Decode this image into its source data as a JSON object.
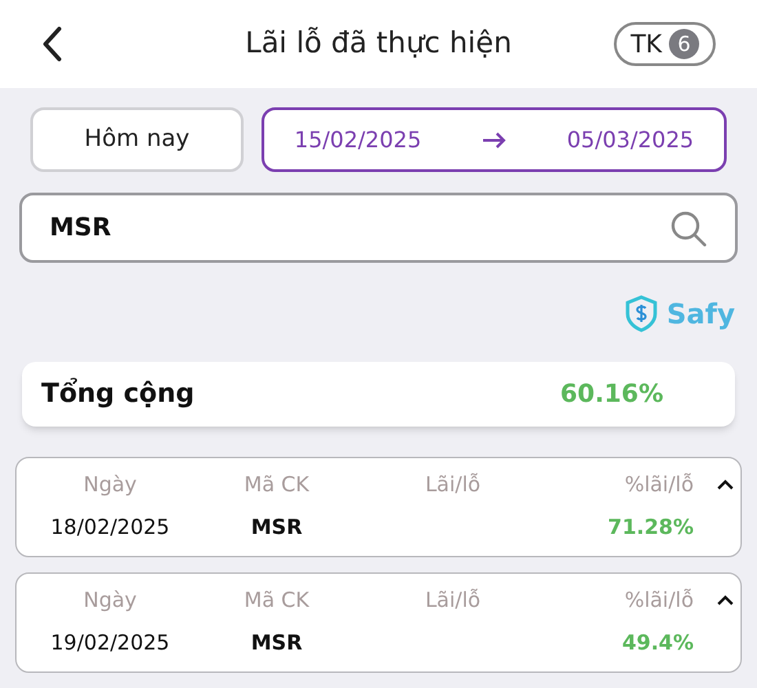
{
  "header": {
    "title": "Lãi lỗ đã thực hiện",
    "account": {
      "label": "TK",
      "count": "6"
    }
  },
  "filters": {
    "today": "Hôm nay",
    "from": "15/02/2025",
    "to": "05/03/2025"
  },
  "search": {
    "value": "MSR"
  },
  "brand": "Safy",
  "total": {
    "label": "Tổng cộng",
    "value": "60.16%"
  },
  "trades": [
    {
      "columns": [
        "Ngày",
        "Mã CK",
        "Lãi/lỗ",
        "%lãi/lỗ"
      ],
      "date": "18/02/2025",
      "symbol": "MSR",
      "percent": "71.28%",
      "expanded": true
    },
    {
      "columns": [
        "Ngày",
        "Mã CK",
        "Lãi/lỗ",
        "%lãi/lỗ"
      ],
      "date": "19/02/2025",
      "symbol": "MSR",
      "percent": "49.4%",
      "expanded": true
    }
  ]
}
